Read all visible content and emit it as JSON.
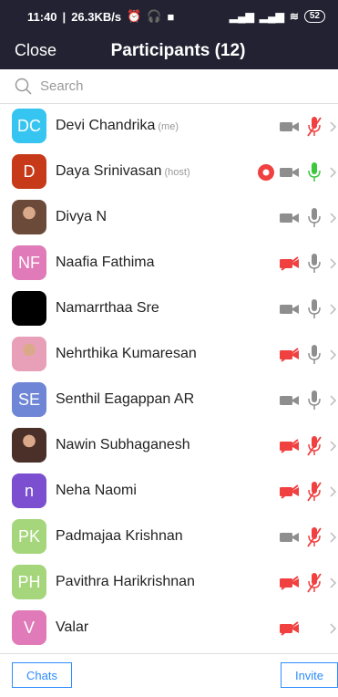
{
  "status_bar": {
    "time": "11:40",
    "network_speed": "26.3KB/s",
    "battery": "52"
  },
  "header": {
    "close_label": "Close",
    "title": "Participants (12)"
  },
  "search": {
    "placeholder": "Search"
  },
  "participants": [
    {
      "name": "Devi Chandrika",
      "tag": "(me)",
      "initials": "DC",
      "avatar_color": "#36c5f0",
      "video": "on",
      "mic": "muted",
      "recording": false
    },
    {
      "name": "Daya Srinivasan",
      "tag": "(host)",
      "initials": "D",
      "avatar_color": "#c63a1a",
      "video": "on",
      "mic": "active",
      "recording": true
    },
    {
      "name": "Divya N",
      "tag": "",
      "initials": "",
      "avatar_color": "#6b4a3a",
      "avatar_photo": true,
      "video": "on",
      "mic": "on",
      "recording": false
    },
    {
      "name": "Naafia Fathima",
      "tag": "",
      "initials": "NF",
      "avatar_color": "#e07ab8",
      "video": "off",
      "mic": "on",
      "recording": false
    },
    {
      "name": "Namarrthaa Sre",
      "tag": "",
      "initials": "",
      "avatar_color": "#000000",
      "video": "on",
      "mic": "on",
      "recording": false
    },
    {
      "name": "Nehrthika Kumaresan",
      "tag": "",
      "initials": "",
      "avatar_color": "#e8a0b8",
      "avatar_photo": true,
      "video": "off",
      "mic": "on",
      "recording": false
    },
    {
      "name": "Senthil Eagappan AR",
      "tag": "",
      "initials": "SE",
      "avatar_color": "#6f86d6",
      "video": "on",
      "mic": "on",
      "recording": false
    },
    {
      "name": "Nawin Subhaganesh",
      "tag": "",
      "initials": "",
      "avatar_color": "#4a3028",
      "avatar_photo": true,
      "video": "off",
      "mic": "muted",
      "recording": false
    },
    {
      "name": "Neha Naomi",
      "tag": "",
      "initials": "n",
      "avatar_color": "#7b4fd0",
      "video": "off",
      "mic": "muted",
      "recording": false
    },
    {
      "name": "Padmajaa Krishnan",
      "tag": "",
      "initials": "PK",
      "avatar_color": "#a5d67b",
      "video": "on",
      "mic": "muted",
      "recording": false
    },
    {
      "name": "Pavithra Harikrishnan",
      "tag": "",
      "initials": "PH",
      "avatar_color": "#a5d67b",
      "video": "off",
      "mic": "muted",
      "recording": false
    },
    {
      "name": "Valar",
      "tag": "",
      "initials": "V",
      "avatar_color": "#e07ab8",
      "video": "off",
      "mic": "none",
      "recording": false
    }
  ],
  "footer": {
    "chats_label": "Chats",
    "invite_label": "Invite"
  },
  "colors": {
    "header_bg": "#222232",
    "accent_blue": "#2d8cff",
    "muted_red": "#f04040",
    "active_green": "#3cc83c",
    "icon_gray": "#8e8e8e"
  }
}
